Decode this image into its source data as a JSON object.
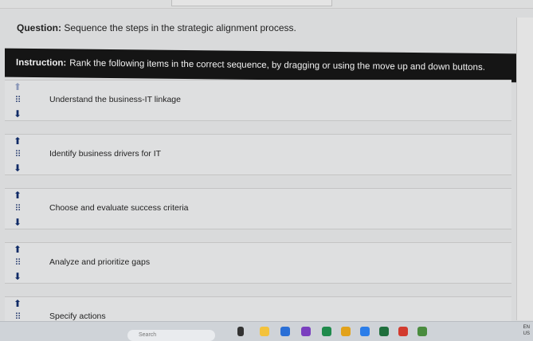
{
  "question": {
    "prefix": "Question:",
    "text": "Sequence the steps in the strategic alignment process."
  },
  "instruction": {
    "prefix": "Instruction:",
    "text": "Rank the following items in the correct sequence, by dragging or using the move up and down buttons."
  },
  "controls": {
    "up_glyph": "⬆",
    "down_glyph": "⬇",
    "grip_glyph": "⠿"
  },
  "items": [
    {
      "label": "Understand the business-IT linkage"
    },
    {
      "label": "Identify business drivers for IT"
    },
    {
      "label": "Choose and evaluate success criteria"
    },
    {
      "label": "Analyze and prioritize gaps"
    },
    {
      "label": "Specify actions"
    }
  ],
  "taskbar": {
    "search_placeholder": "Search",
    "clock_line1": "EN",
    "clock_line2": "US",
    "icon_colors": [
      "#1e73c9",
      "#f3c23c",
      "#2a6fd6",
      "#7a3fbf",
      "#1f8a4c",
      "#e2a21b",
      "#2b7de9",
      "#1f6f3d",
      "#d23b2f",
      "#4a8c3f"
    ]
  }
}
